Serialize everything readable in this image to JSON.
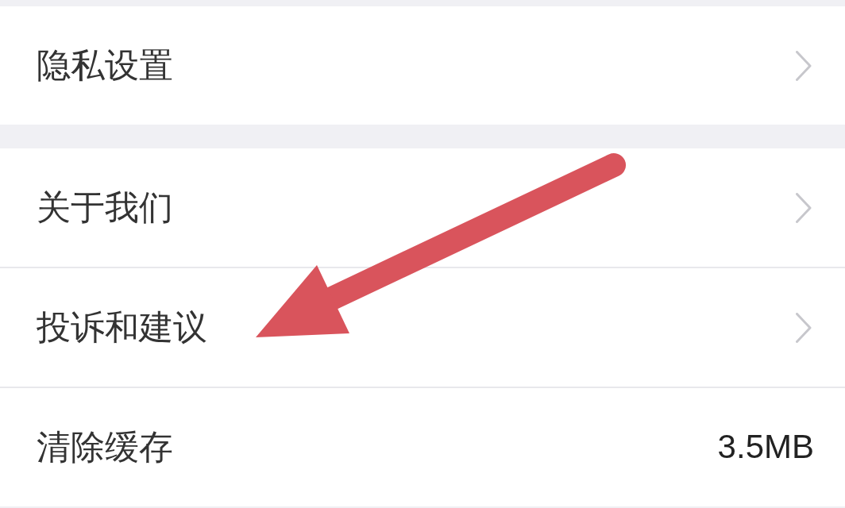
{
  "groups": [
    {
      "items": [
        {
          "label": "隐私设置",
          "kind": "link"
        }
      ]
    },
    {
      "items": [
        {
          "label": "关于我们",
          "kind": "link"
        },
        {
          "label": "投诉和建议",
          "kind": "link"
        },
        {
          "label": "清除缓存",
          "kind": "value",
          "value": "3.5MB"
        }
      ]
    }
  ]
}
